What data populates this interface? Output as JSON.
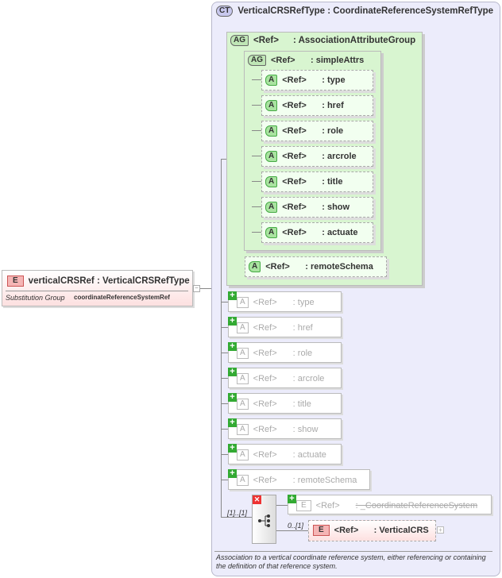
{
  "element": {
    "badge": "E",
    "name": "verticalCRSRef : VerticalCRSRefType",
    "subst_label": "Substitution Group",
    "subst_value": "coordinateReferenceSystemRef"
  },
  "complex_type": {
    "badge": "CT",
    "title": "VerticalCRSRefType : CoordinateReferenceSystemRefType"
  },
  "attr_group": {
    "badge": "AG",
    "ref": "<Ref>",
    "name": ": AssociationAttributeGroup"
  },
  "simple_attrs": {
    "badge": "AG",
    "ref": "<Ref>",
    "name": ": simpleAttrs"
  },
  "inner_attrs": [
    {
      "badge": "A",
      "ref": "<Ref>",
      "name": ": type"
    },
    {
      "badge": "A",
      "ref": "<Ref>",
      "name": ": href"
    },
    {
      "badge": "A",
      "ref": "<Ref>",
      "name": ": role"
    },
    {
      "badge": "A",
      "ref": "<Ref>",
      "name": ": arcrole"
    },
    {
      "badge": "A",
      "ref": "<Ref>",
      "name": ": title"
    },
    {
      "badge": "A",
      "ref": "<Ref>",
      "name": ": show"
    },
    {
      "badge": "A",
      "ref": "<Ref>",
      "name": ": actuate"
    }
  ],
  "remote_schema": {
    "badge": "A",
    "ref": "<Ref>",
    "name": ": remoteSchema"
  },
  "inherited_attrs": [
    {
      "badge": "A",
      "ref": "<Ref>",
      "name": ": type"
    },
    {
      "badge": "A",
      "ref": "<Ref>",
      "name": ": href"
    },
    {
      "badge": "A",
      "ref": "<Ref>",
      "name": ": role"
    },
    {
      "badge": "A",
      "ref": "<Ref>",
      "name": ": arcrole"
    },
    {
      "badge": "A",
      "ref": "<Ref>",
      "name": ": title"
    },
    {
      "badge": "A",
      "ref": "<Ref>",
      "name": ": show"
    },
    {
      "badge": "A",
      "ref": "<Ref>",
      "name": ": actuate"
    },
    {
      "badge": "A",
      "ref": "<Ref>",
      "name": ": remoteSchema"
    }
  ],
  "choice": {
    "multiplicity": "[1]..[1]"
  },
  "choice_items": [
    {
      "badge": "E",
      "ref": "<Ref>",
      "name": ": _CoordinateReferenceSystem"
    },
    {
      "badge": "E",
      "ref": "<Ref>",
      "name": ": VerticalCRS",
      "multiplicity": "0..[1]"
    }
  ],
  "description": "Association to a vertical coordinate reference system, either referencing or containing the definition of that reference system."
}
